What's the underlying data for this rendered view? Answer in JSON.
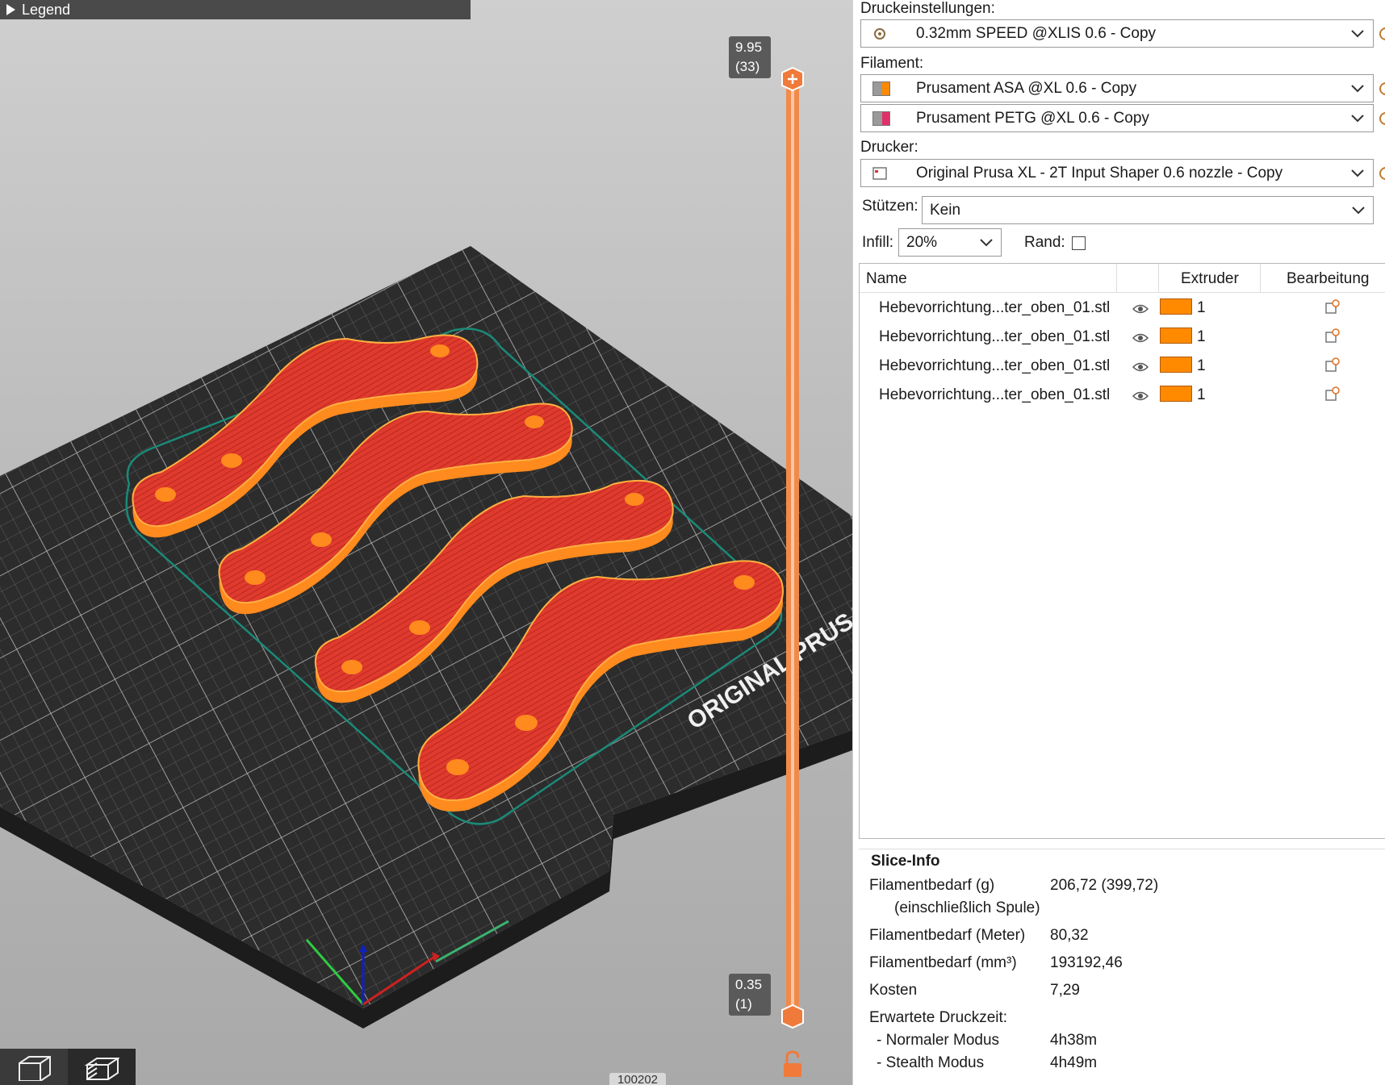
{
  "viewport": {
    "legend_label": "Legend",
    "layer_top": {
      "height": "9.95",
      "layer": "(33)"
    },
    "layer_bottom": {
      "height": "0.35",
      "layer": "(1)"
    },
    "bed_text": "ORIGINAL PRUSA",
    "bottom_readout": "100202",
    "colors": {
      "part_top": "#e03a2e",
      "part_wall": "#ff8a1e",
      "slider": "#f08a4b",
      "bed": "#2c2c2c",
      "skirt": "#1a8a78"
    }
  },
  "panel": {
    "print_settings_label": "Druckeinstellungen:",
    "print_settings_value": "0.32mm SPEED @XLIS 0.6 - Copy",
    "filament_label": "Filament:",
    "filaments": [
      {
        "name": "Prusament ASA @XL 0.6 - Copy",
        "color": "#ff8a00"
      },
      {
        "name": "Prusament PETG @XL 0.6 - Copy",
        "color": "#e0306a"
      }
    ],
    "printer_label": "Drucker:",
    "printer_value": "Original Prusa XL - 2T Input Shaper 0.6 nozzle - Copy",
    "supports_label": "Stützen:",
    "supports_value": "Kein",
    "infill_label": "Infill:",
    "infill_value": "20%",
    "brim_label": "Rand:",
    "brim_checked": false,
    "columns": {
      "name": "Name",
      "extruder": "Extruder",
      "edit": "Bearbeitung"
    },
    "objects": [
      {
        "name": "Hebevorrichtung...ter_oben_01.stl",
        "extruder": "1"
      },
      {
        "name": "Hebevorrichtung...ter_oben_01.stl",
        "extruder": "1"
      },
      {
        "name": "Hebevorrichtung...ter_oben_01.stl",
        "extruder": "1"
      },
      {
        "name": "Hebevorrichtung...ter_oben_01.stl",
        "extruder": "1"
      }
    ],
    "slice_info": {
      "title": "Slice-Info",
      "filament_g_label": "Filamentbedarf (g)",
      "filament_g_sub": "(einschließlich Spule)",
      "filament_g_value": "206,72 (399,72)",
      "filament_m_label": "Filamentbedarf (Meter)",
      "filament_m_value": "80,32",
      "filament_mm3_label": "Filamentbedarf (mm³)",
      "filament_mm3_value": "193192,46",
      "cost_label": "Kosten",
      "cost_value": "7,29",
      "time_label": "Erwartete Druckzeit:",
      "normal_label": "- Normaler Modus",
      "normal_value": "4h38m",
      "stealth_label": "- Stealth Modus",
      "stealth_value": "4h49m"
    }
  }
}
